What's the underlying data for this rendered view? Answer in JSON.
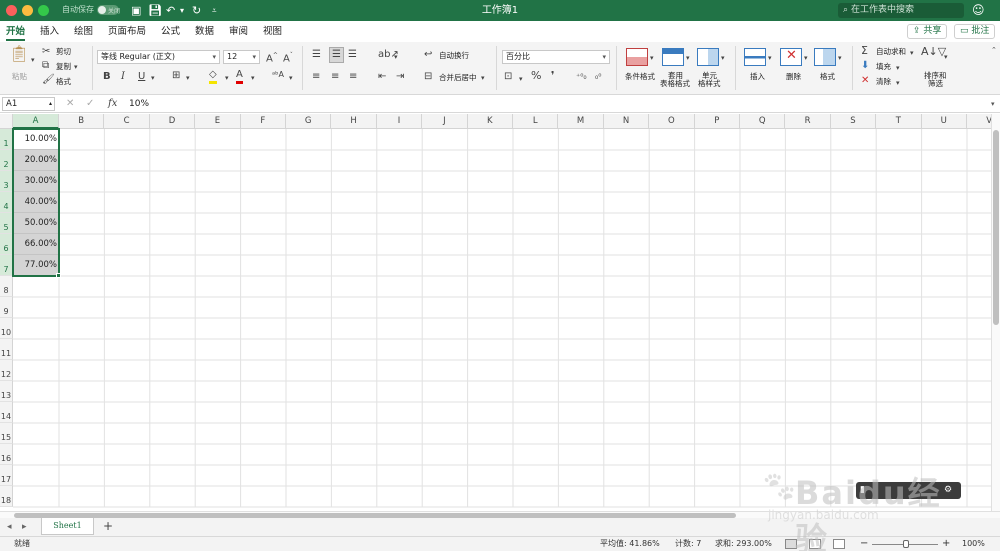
{
  "titlebar": {
    "autosave_label": "自动保存",
    "autosave_state": "关闭",
    "title": "工作簿1",
    "search_placeholder": "在工作表中搜索"
  },
  "tabs": [
    {
      "label": "开始",
      "active": true
    },
    {
      "label": "插入"
    },
    {
      "label": "绘图"
    },
    {
      "label": "页面布局"
    },
    {
      "label": "公式"
    },
    {
      "label": "数据"
    },
    {
      "label": "审阅"
    },
    {
      "label": "视图"
    }
  ],
  "share_label": "共享",
  "comment_label": "批注",
  "ribbon": {
    "paste": "粘贴",
    "cut": "剪切",
    "copy": "复制",
    "format_painter": "格式",
    "font_name": "等线 Regular (正文)",
    "font_size": "12",
    "bold": "B",
    "italic": "I",
    "underline": "U",
    "wrap_text": "自动换行",
    "merge_center": "合并后居中",
    "number_format": "百分比",
    "conditional_format": "条件格式",
    "table_format_line1": "套用",
    "table_format_line2": "表格格式",
    "cell_styles_line1": "单元",
    "cell_styles_line2": "格样式",
    "insert": "插入",
    "delete": "删除",
    "format": "格式",
    "autosum": "自动求和",
    "fill": "填充",
    "clear": "清除",
    "sort_filter_line1": "排序和",
    "sort_filter_line2": "筛选"
  },
  "formula_bar": {
    "name_box": "A1",
    "fx": "fx",
    "value": "10%"
  },
  "columns": [
    "A",
    "B",
    "C",
    "D",
    "E",
    "F",
    "G",
    "H",
    "I",
    "J",
    "K",
    "L",
    "M",
    "N",
    "O",
    "P",
    "Q",
    "R",
    "S",
    "T",
    "U",
    "V"
  ],
  "rows": [
    "1",
    "2",
    "3",
    "4",
    "5",
    "6",
    "7",
    "8",
    "9",
    "10",
    "11",
    "12",
    "13",
    "14",
    "15",
    "16",
    "17",
    "18"
  ],
  "cells_A": [
    "10.00%",
    "20.00%",
    "30.00%",
    "40.00%",
    "50.00%",
    "66.00%",
    "77.00%"
  ],
  "sheet_tab": "Sheet1",
  "status": {
    "ready": "就绪",
    "average": "平均值: 41.86%",
    "count": "计数: 7",
    "sum": "求和: 293.00%",
    "zoom": "100%"
  },
  "watermark": {
    "text": "Baidu经验",
    "url": "jingyan.baidu.com"
  },
  "colors": {
    "accent": "#217346",
    "selection": "#d4d4d4"
  }
}
